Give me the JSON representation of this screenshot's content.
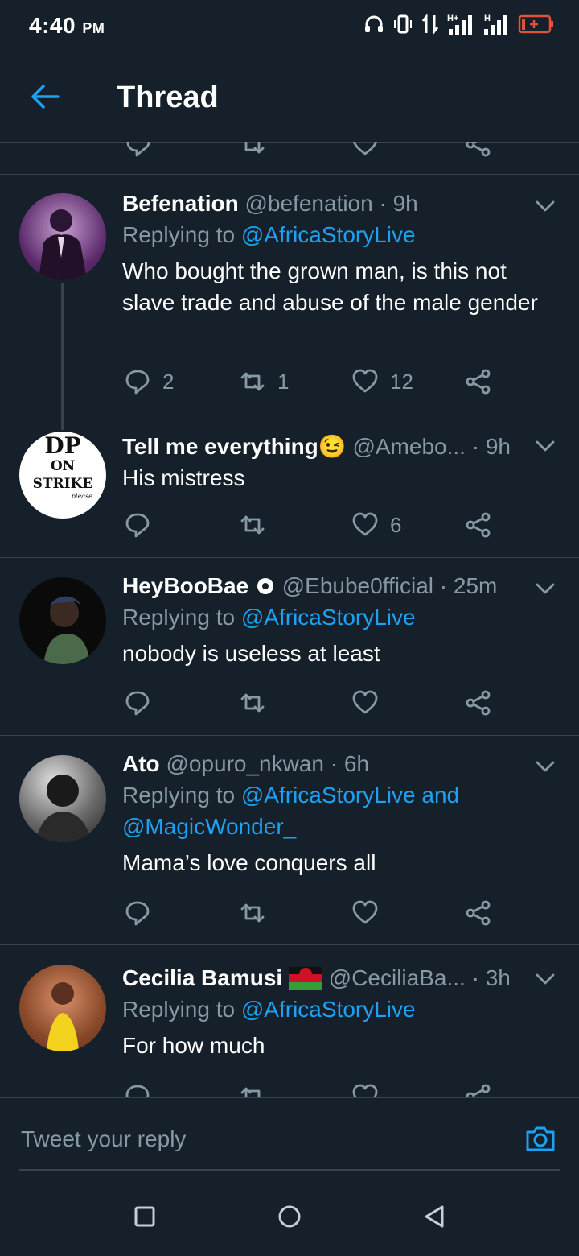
{
  "status_bar": {
    "time": "4:40",
    "ampm": "PM"
  },
  "header": {
    "title": "Thread"
  },
  "tweets": [
    {
      "name": "Befenation",
      "handle": "@befenation",
      "time": "9h",
      "replying_prefix": "Replying to",
      "replying_to": "@AfricaStoryLive",
      "text": "Who bought the grown man, is this not slave trade and  abuse of the male gender",
      "replies": "2",
      "retweets": "1",
      "likes": "12"
    },
    {
      "name": "Tell me everything",
      "emoji": "😉",
      "handle": "@Amebo...",
      "time": "9h",
      "avatar_text": [
        "DP",
        "ON",
        "STRIKE",
        "...please"
      ],
      "text": "His mistress",
      "replies": "",
      "retweets": "",
      "likes": "6"
    },
    {
      "name": "HeyBooBae",
      "handle": "@Ebube0fficial",
      "time": "25m",
      "replying_prefix": "Replying to",
      "replying_to": "@AfricaStoryLive",
      "text": "nobody is useless at least",
      "replies": "",
      "retweets": "",
      "likes": ""
    },
    {
      "name": "Ato",
      "handle": "@opuro_nkwan",
      "time": "6h",
      "replying_prefix": "Replying to",
      "replying_to": "@AfricaStoryLive and",
      "replying_to_2": "@MagicWonder_",
      "text": "Mama’s love conquers all",
      "replies": "",
      "retweets": "",
      "likes": ""
    },
    {
      "name": "Cecilia Bamusi",
      "handle": "@CeciliaBa...",
      "time": "3h",
      "replying_prefix": "Replying to",
      "replying_to": "@AfricaStoryLive",
      "text": "For how much"
    }
  ],
  "composer": {
    "placeholder": "Tweet your reply"
  },
  "colors": {
    "background": "#15202b",
    "accent": "#1da1f2",
    "muted": "#8899a6",
    "divider": "#38444d"
  }
}
